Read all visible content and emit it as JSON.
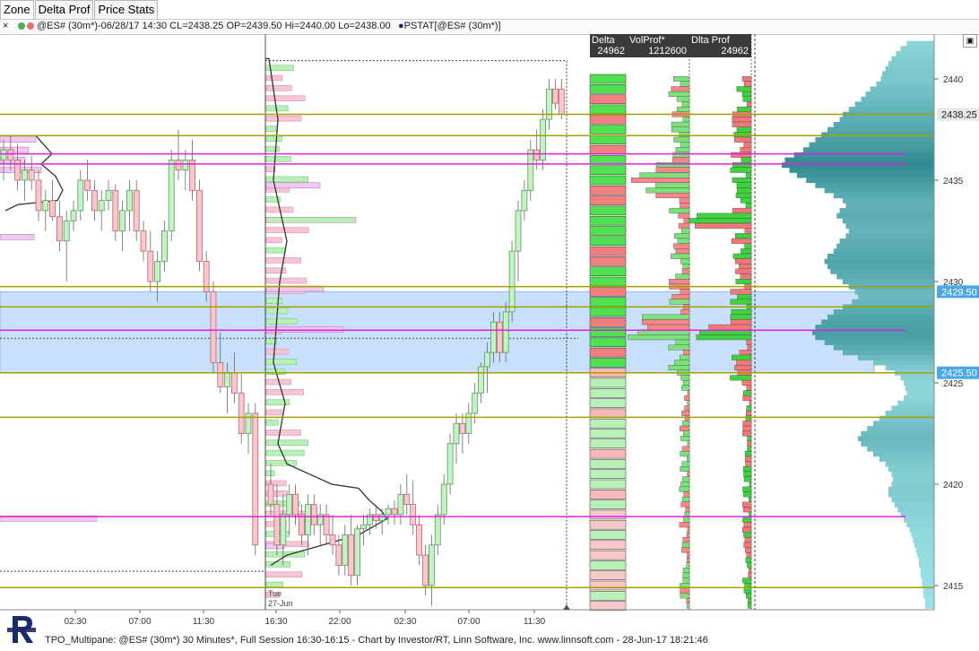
{
  "tabs": [
    {
      "label": "Zone",
      "active": true
    },
    {
      "label": "Delta Prof",
      "active": false
    },
    {
      "label": "Price Stats",
      "active": false
    }
  ],
  "infobar": {
    "close_glyph": "×",
    "dot_colors": [
      "#4caf50",
      "#e57373"
    ],
    "series_text": "@ES# (30m*)-06/28/17 14:30 CL=2438.25 OP=2439.50 Hi=2440.00 Lo=2438.00",
    "indicator_text": "PSTAT[@ES# (30m*)]",
    "indicator_dot_color": "#1a237e"
  },
  "chart_data": {
    "type": "candlestick-tpo",
    "ylim": [
      2413.5,
      2442.5
    ],
    "y_ticks": [
      2415,
      2420,
      2425,
      2430,
      2435,
      2440
    ],
    "x_ticks": [
      "02:30",
      "07:00",
      "11:30",
      "16:30",
      "22:00",
      "02:30",
      "07:00",
      "11:30"
    ],
    "x_date_label": "27-Jun",
    "x_date_prefix": "Tue",
    "price_labels": [
      {
        "value": 2438.25,
        "text": "2438.25",
        "style": "last"
      },
      {
        "value": 2429.5,
        "text": "2429.50",
        "style": "zone"
      },
      {
        "value": 2425.5,
        "text": "2425.50",
        "style": "zone"
      }
    ],
    "zone": {
      "high": 2429.5,
      "low": 2425.5
    },
    "olive_levels": [
      2438.25,
      2437.2,
      2429.75,
      2428.75,
      2425.5,
      2423.3,
      2414.9
    ],
    "magenta_levels": [
      2436.3,
      2435.8,
      2427.6,
      2418.4
    ],
    "columns": {
      "delta": {
        "header": "Delta",
        "value": "24962"
      },
      "volprof": {
        "header": "VolProf*",
        "value": "1212600"
      },
      "dltaprof": {
        "header": "Dlta Prof",
        "value": "24962"
      }
    },
    "candles_day1": [
      [
        2436.0,
        2437.0,
        2435.0,
        2436.5
      ],
      [
        2436.5,
        2437.2,
        2435.5,
        2436.0
      ],
      [
        2436.0,
        2436.8,
        2434.5,
        2435.0
      ],
      [
        2435.0,
        2436.0,
        2434.0,
        2435.5
      ],
      [
        2435.5,
        2436.2,
        2434.5,
        2435.0
      ],
      [
        2435.0,
        2435.5,
        2433.0,
        2433.5
      ],
      [
        2433.5,
        2434.5,
        2432.5,
        2434.0
      ],
      [
        2434.0,
        2435.0,
        2433.0,
        2433.2
      ],
      [
        2433.2,
        2434.0,
        2431.5,
        2432.0
      ],
      [
        2432.0,
        2433.5,
        2430.0,
        2433.0
      ],
      [
        2433.0,
        2434.0,
        2432.5,
        2433.5
      ],
      [
        2433.5,
        2435.5,
        2433.0,
        2435.0
      ],
      [
        2435.0,
        2436.0,
        2434.0,
        2434.5
      ],
      [
        2434.5,
        2435.0,
        2433.0,
        2433.5
      ],
      [
        2433.5,
        2434.5,
        2432.5,
        2434.0
      ],
      [
        2434.0,
        2435.0,
        2433.5,
        2434.5
      ],
      [
        2434.5,
        2434.8,
        2432.0,
        2432.5
      ],
      [
        2432.5,
        2434.0,
        2431.5,
        2433.5
      ],
      [
        2433.5,
        2435.0,
        2432.5,
        2434.5
      ],
      [
        2434.5,
        2435.0,
        2432.0,
        2432.5
      ],
      [
        2432.5,
        2433.0,
        2431.0,
        2431.5
      ],
      [
        2431.5,
        2432.5,
        2429.5,
        2430.0
      ],
      [
        2430.0,
        2431.5,
        2429.0,
        2431.0
      ],
      [
        2431.0,
        2433.0,
        2430.5,
        2432.5
      ],
      [
        2432.5,
        2436.5,
        2432.0,
        2436.0
      ],
      [
        2436.0,
        2437.5,
        2435.0,
        2435.5
      ],
      [
        2435.5,
        2436.5,
        2434.5,
        2436.0
      ],
      [
        2436.0,
        2437.0,
        2434.0,
        2434.5
      ],
      [
        2434.5,
        2435.0,
        2430.5,
        2431.0
      ],
      [
        2431.0,
        2431.5,
        2429.0,
        2429.5
      ],
      [
        2429.5,
        2430.0,
        2425.5,
        2426.0
      ],
      [
        2426.0,
        2427.5,
        2424.5,
        2424.8
      ],
      [
        2424.8,
        2426.0,
        2423.5,
        2425.5
      ],
      [
        2425.5,
        2426.5,
        2424.0,
        2424.5
      ],
      [
        2424.5,
        2425.5,
        2422.0,
        2422.5
      ],
      [
        2422.5,
        2424.0,
        2421.5,
        2423.5
      ],
      [
        2423.5,
        2424.0,
        2416.5,
        2417.0
      ]
    ],
    "candles_day2": [
      [
        2420.0,
        2421.0,
        2418.5,
        2419.0
      ],
      [
        2419.0,
        2420.0,
        2416.5,
        2417.0
      ],
      [
        2417.0,
        2419.5,
        2416.0,
        2418.5
      ],
      [
        2418.5,
        2420.0,
        2417.5,
        2419.5
      ],
      [
        2419.5,
        2420.0,
        2418.0,
        2418.5
      ],
      [
        2418.5,
        2419.0,
        2417.0,
        2417.5
      ],
      [
        2417.5,
        2419.5,
        2416.5,
        2419.0
      ],
      [
        2419.0,
        2419.5,
        2417.5,
        2418.0
      ],
      [
        2418.0,
        2419.0,
        2417.0,
        2418.5
      ],
      [
        2418.5,
        2419.0,
        2417.0,
        2417.5
      ],
      [
        2417.5,
        2418.5,
        2416.5,
        2417.0
      ],
      [
        2417.0,
        2417.5,
        2415.5,
        2416.0
      ],
      [
        2416.0,
        2418.0,
        2415.5,
        2417.5
      ],
      [
        2417.5,
        2418.5,
        2415.0,
        2415.5
      ],
      [
        2415.5,
        2418.0,
        2415.0,
        2417.8
      ],
      [
        2417.8,
        2418.5,
        2417.0,
        2418.0
      ],
      [
        2418.0,
        2418.8,
        2417.5,
        2418.5
      ],
      [
        2418.5,
        2419.0,
        2417.8,
        2418.2
      ],
      [
        2418.2,
        2418.8,
        2417.5,
        2418.5
      ],
      [
        2418.5,
        2419.0,
        2418.0,
        2418.8
      ],
      [
        2418.8,
        2419.2,
        2418.0,
        2418.5
      ],
      [
        2418.5,
        2420.0,
        2418.0,
        2419.5
      ],
      [
        2419.5,
        2420.5,
        2418.5,
        2419.0
      ],
      [
        2419.0,
        2420.2,
        2417.5,
        2418.0
      ],
      [
        2418.0,
        2418.5,
        2416.0,
        2416.5
      ],
      [
        2416.5,
        2417.0,
        2414.5,
        2415.0
      ],
      [
        2415.0,
        2417.5,
        2414.0,
        2417.0
      ],
      [
        2417.0,
        2419.0,
        2416.5,
        2418.5
      ],
      [
        2418.5,
        2420.5,
        2418.0,
        2420.0
      ],
      [
        2420.0,
        2422.5,
        2419.5,
        2422.0
      ],
      [
        2422.0,
        2423.5,
        2421.0,
        2423.0
      ],
      [
        2423.0,
        2423.5,
        2421.5,
        2422.5
      ],
      [
        2422.5,
        2424.0,
        2422.0,
        2423.5
      ],
      [
        2423.5,
        2425.0,
        2423.0,
        2424.5
      ],
      [
        2424.5,
        2426.0,
        2424.0,
        2425.8
      ],
      [
        2425.8,
        2427.0,
        2424.5,
        2426.5
      ],
      [
        2426.5,
        2428.5,
        2426.0,
        2428.0
      ],
      [
        2428.0,
        2428.5,
        2426.0,
        2426.5
      ],
      [
        2426.5,
        2429.0,
        2426.0,
        2428.5
      ],
      [
        2428.5,
        2432.0,
        2428.0,
        2431.5
      ],
      [
        2431.5,
        2434.0,
        2430.0,
        2433.5
      ],
      [
        2433.5,
        2435.0,
        2433.0,
        2434.5
      ],
      [
        2434.5,
        2437.0,
        2434.0,
        2436.5
      ],
      [
        2436.5,
        2437.5,
        2435.5,
        2436.0
      ],
      [
        2436.0,
        2438.5,
        2435.5,
        2438.0
      ],
      [
        2438.0,
        2440.0,
        2437.5,
        2439.5
      ],
      [
        2439.5,
        2440.0,
        2438.5,
        2438.8
      ],
      [
        2439.5,
        2440.0,
        2438.0,
        2438.25
      ]
    ],
    "volume_profile_day1": [
      [
        2437.5,
        0.4
      ],
      [
        2437.25,
        0.55
      ],
      [
        2437.0,
        0.7
      ],
      [
        2436.75,
        0.8
      ],
      [
        2436.5,
        0.9
      ],
      [
        2436.25,
        1.0
      ],
      [
        2436.0,
        0.95
      ],
      [
        2435.75,
        0.85
      ],
      [
        2435.5,
        0.9
      ],
      [
        2435.25,
        0.7
      ],
      [
        2435.0,
        0.6
      ],
      [
        2434.75,
        0.5
      ]
    ],
    "volume_profile_main": [
      [
        2441.75,
        0.18
      ],
      [
        2441.5,
        0.22
      ],
      [
        2441.25,
        0.25
      ],
      [
        2441.0,
        0.28
      ],
      [
        2440.75,
        0.3
      ],
      [
        2440.5,
        0.32
      ],
      [
        2440.25,
        0.34
      ],
      [
        2440.0,
        0.35
      ],
      [
        2439.75,
        0.38
      ],
      [
        2439.5,
        0.42
      ],
      [
        2439.25,
        0.45
      ],
      [
        2439.0,
        0.48
      ],
      [
        2438.75,
        0.52
      ],
      [
        2438.5,
        0.56
      ],
      [
        2438.25,
        0.6
      ],
      [
        2438.0,
        0.62
      ],
      [
        2437.75,
        0.66
      ],
      [
        2437.5,
        0.7
      ],
      [
        2437.25,
        0.74
      ],
      [
        2437.0,
        0.78
      ],
      [
        2436.75,
        0.82
      ],
      [
        2436.5,
        0.86
      ],
      [
        2436.25,
        0.92
      ],
      [
        2436.0,
        0.98
      ],
      [
        2435.75,
        1.0
      ],
      [
        2435.5,
        0.95
      ],
      [
        2435.25,
        0.9
      ],
      [
        2435.0,
        0.84
      ],
      [
        2434.75,
        0.78
      ],
      [
        2434.5,
        0.72
      ],
      [
        2434.25,
        0.66
      ],
      [
        2434.0,
        0.6
      ],
      [
        2433.75,
        0.58
      ],
      [
        2433.5,
        0.62
      ],
      [
        2433.25,
        0.64
      ],
      [
        2433.0,
        0.6
      ],
      [
        2432.75,
        0.58
      ],
      [
        2432.5,
        0.56
      ],
      [
        2432.25,
        0.58
      ],
      [
        2432.0,
        0.62
      ],
      [
        2431.75,
        0.64
      ],
      [
        2431.5,
        0.66
      ],
      [
        2431.25,
        0.7
      ],
      [
        2431.0,
        0.72
      ],
      [
        2430.75,
        0.7
      ],
      [
        2430.5,
        0.68
      ],
      [
        2430.25,
        0.64
      ],
      [
        2430.0,
        0.6
      ],
      [
        2429.75,
        0.56
      ],
      [
        2429.5,
        0.52
      ],
      [
        2429.25,
        0.5
      ],
      [
        2429.0,
        0.54
      ],
      [
        2428.75,
        0.6
      ],
      [
        2428.5,
        0.66
      ],
      [
        2428.25,
        0.7
      ],
      [
        2428.0,
        0.74
      ],
      [
        2427.75,
        0.78
      ],
      [
        2427.5,
        0.8
      ],
      [
        2427.25,
        0.78
      ],
      [
        2427.0,
        0.72
      ],
      [
        2426.75,
        0.66
      ],
      [
        2426.5,
        0.6
      ],
      [
        2426.25,
        0.5
      ],
      [
        2426.0,
        0.4
      ],
      [
        2425.75,
        0.32
      ],
      [
        2425.5,
        0.26
      ],
      [
        2425.25,
        0.22
      ],
      [
        2425.0,
        0.2
      ],
      [
        2424.75,
        0.19
      ],
      [
        2424.5,
        0.18
      ],
      [
        2424.25,
        0.2
      ],
      [
        2424.0,
        0.24
      ],
      [
        2423.75,
        0.28
      ],
      [
        2423.5,
        0.32
      ],
      [
        2423.25,
        0.36
      ],
      [
        2423.0,
        0.4
      ],
      [
        2422.75,
        0.44
      ],
      [
        2422.5,
        0.48
      ],
      [
        2422.25,
        0.5
      ],
      [
        2422.0,
        0.48
      ],
      [
        2421.75,
        0.44
      ],
      [
        2421.5,
        0.4
      ],
      [
        2421.25,
        0.36
      ],
      [
        2421.0,
        0.32
      ],
      [
        2420.75,
        0.3
      ],
      [
        2420.5,
        0.28
      ],
      [
        2420.25,
        0.27
      ],
      [
        2420.0,
        0.28
      ],
      [
        2419.75,
        0.3
      ],
      [
        2419.5,
        0.3
      ],
      [
        2419.25,
        0.28
      ],
      [
        2419.0,
        0.26
      ],
      [
        2418.75,
        0.24
      ],
      [
        2418.5,
        0.22
      ],
      [
        2418.25,
        0.2
      ],
      [
        2418.0,
        0.18
      ],
      [
        2417.75,
        0.16
      ],
      [
        2417.5,
        0.15
      ],
      [
        2417.25,
        0.14
      ],
      [
        2417.0,
        0.13
      ],
      [
        2416.75,
        0.12
      ],
      [
        2416.5,
        0.11
      ],
      [
        2416.25,
        0.1
      ],
      [
        2416.0,
        0.1
      ],
      [
        2415.75,
        0.09
      ],
      [
        2415.5,
        0.09
      ],
      [
        2415.25,
        0.08
      ],
      [
        2415.0,
        0.08
      ],
      [
        2414.75,
        0.07
      ],
      [
        2414.5,
        0.07
      ],
      [
        2414.25,
        0.06
      ],
      [
        2414.0,
        0.06
      ]
    ]
  },
  "footer": {
    "text": "TPO_Multipane: @ES# (30m*) 30 Minutes*, Full Session 16:30-16:15 - Chart by Investor/RT, Linn Software, Inc. www.linnsoft.com - 28-Jun-17 18:21:46",
    "logo_text": "INVESTOR/RT"
  }
}
